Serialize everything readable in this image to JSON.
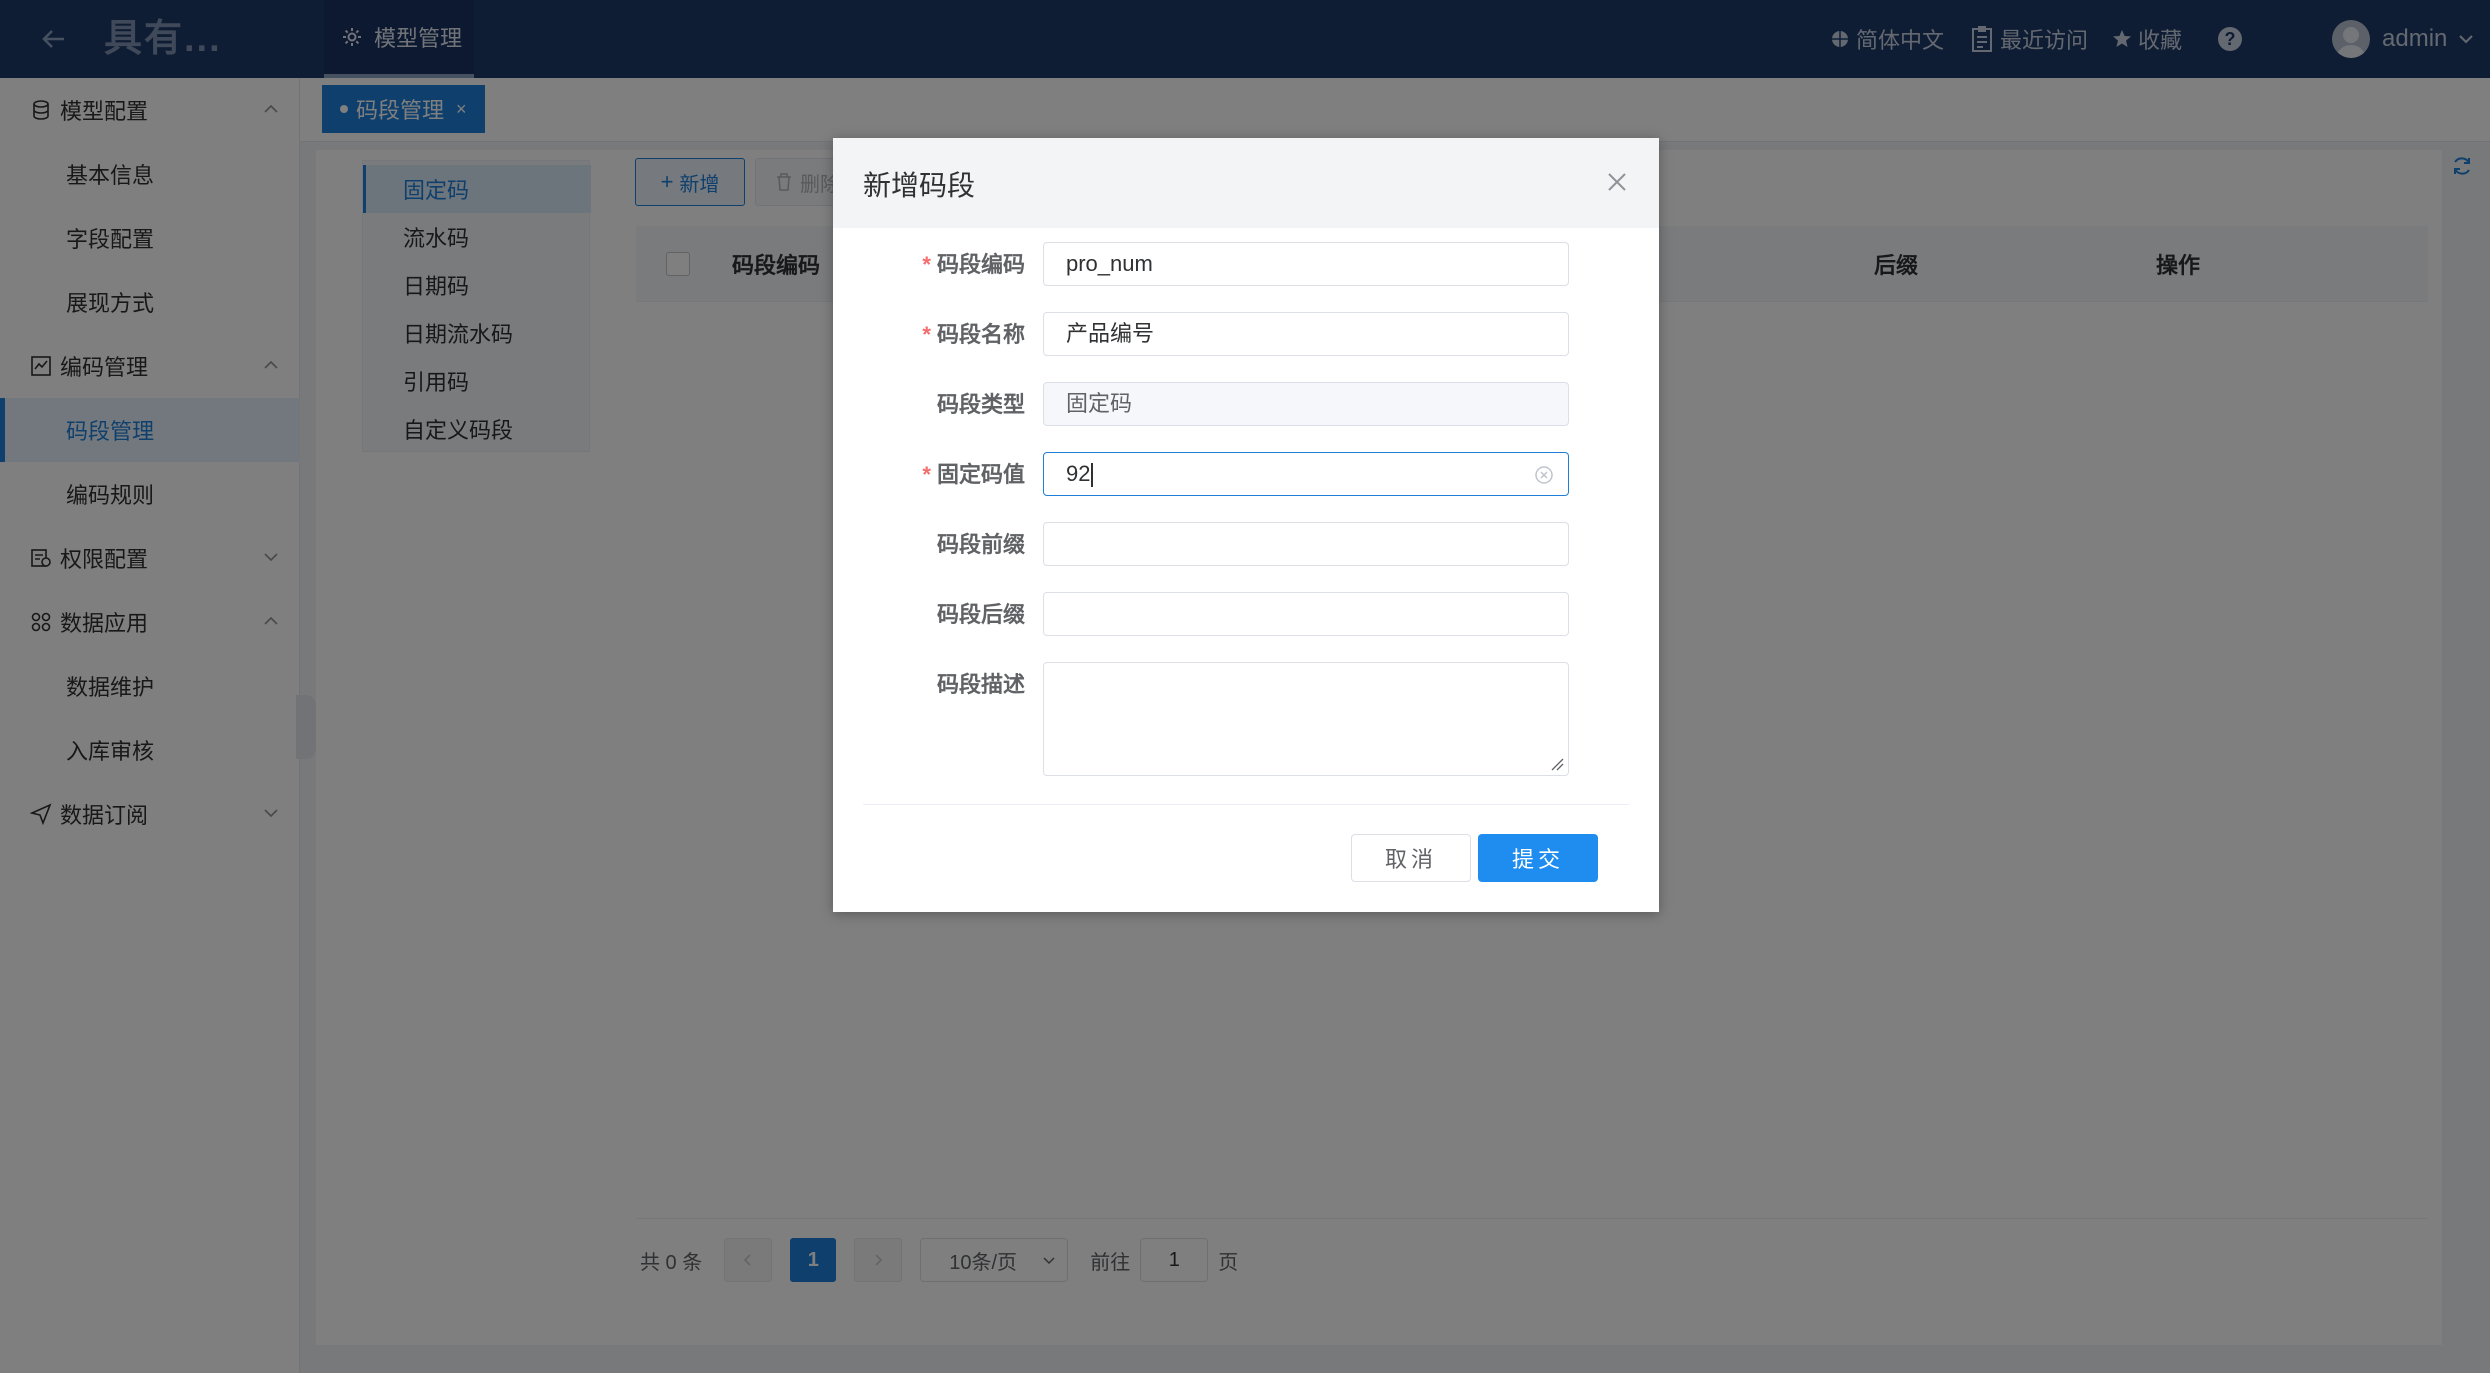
{
  "header": {
    "logo": "具有...",
    "nav_item": "模型管理",
    "language": "简体中文",
    "recent": "最近访问",
    "favorites": "收藏",
    "help": "?",
    "user": "admin"
  },
  "sidebar": {
    "groups": [
      {
        "label": "模型配置",
        "items": [
          "基本信息",
          "字段配置",
          "展现方式"
        ]
      },
      {
        "label": "编码管理",
        "items": [
          "码段管理",
          "编码规则"
        ]
      },
      {
        "label": "权限配置",
        "items": []
      },
      {
        "label": "数据应用",
        "items": [
          "数据维护",
          "入库审核"
        ]
      },
      {
        "label": "数据订阅",
        "items": []
      }
    ],
    "active_item": "码段管理"
  },
  "tabs": [
    {
      "label": "码段管理",
      "close": "×"
    }
  ],
  "segment_types": [
    "固定码",
    "流水码",
    "日期码",
    "日期流水码",
    "引用码",
    "自定义码段"
  ],
  "toolbar": {
    "add": "新增",
    "delete": "删除"
  },
  "table": {
    "columns": [
      "码段编码",
      "后缀",
      "操作"
    ]
  },
  "pagination": {
    "total": "共 0 条",
    "current_page": "1",
    "page_size": "10条/页",
    "goto_label": "前往",
    "goto_value": "1",
    "page_suffix": "页"
  },
  "dialog": {
    "title": "新增码段",
    "fields": [
      {
        "label": "码段编码",
        "required": true,
        "value": "pro_num"
      },
      {
        "label": "码段名称",
        "required": true,
        "value": "产品编号"
      },
      {
        "label": "码段类型",
        "required": false,
        "value": "固定码"
      },
      {
        "label": "固定码值",
        "required": true,
        "value": "92"
      },
      {
        "label": "码段前缀",
        "required": false,
        "value": ""
      },
      {
        "label": "码段后缀",
        "required": false,
        "value": ""
      },
      {
        "label": "码段描述",
        "required": false,
        "value": ""
      }
    ],
    "required_mark": "*",
    "cancel": "取消",
    "submit": "提交"
  },
  "colors": {
    "primary": "#1f7fd8",
    "header_bg": "#1f3a68",
    "required": "#f56c6c"
  }
}
